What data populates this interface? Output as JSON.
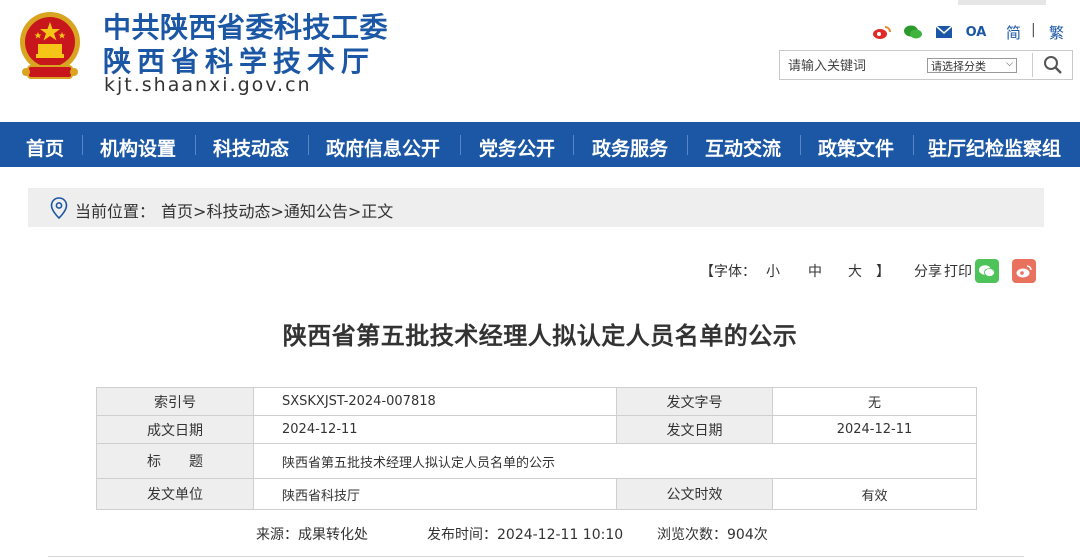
{
  "header": {
    "title_line1": "中共陕西省委科技工委",
    "title_line2": "陕西省科学技术厅",
    "domain": "kjt.shaanxi.gov.cn",
    "icons": [
      "weibo-icon",
      "wechat-icon",
      "mail-icon"
    ],
    "oa_label": "OA",
    "lang_simplified": "简",
    "lang_separator": "|",
    "lang_traditional": "繁",
    "search": {
      "placeholder": "请输入关键词",
      "category_selected": "请选择分类"
    },
    "brand_color": "#1b57a4"
  },
  "nav": {
    "items": [
      "首页",
      "机构设置",
      "科技动态",
      "政府信息公开",
      "党务公开",
      "政务服务",
      "互动交流",
      "政策文件",
      "驻厅纪检监察组"
    ]
  },
  "breadcrumb": {
    "prefix": "当前位置：",
    "items": [
      "首页",
      "科技动态",
      "通知公告",
      "正文"
    ],
    "separator": ">"
  },
  "tools": {
    "font_open": "【字体：",
    "font_small": "小",
    "font_medium": "中",
    "font_large": "大",
    "font_close": "】",
    "share_label": "分享",
    "print_label": "打印",
    "share_icons": [
      "wechat-share-icon",
      "weibo-share-icon"
    ],
    "share_colors": {
      "wechat": "#4ec35a",
      "weibo": "#e9725e"
    }
  },
  "article": {
    "title": "陕西省第五批技术经理人拟认定人员名单的公示"
  },
  "meta": {
    "index_label": "索引号",
    "index_value": "SXSKXJST-2024-007818",
    "doc_no_label": "发文字号",
    "doc_no_value": "无",
    "created_label": "成文日期",
    "created_value": "2024-12-11",
    "issued_label": "发文日期",
    "issued_value": "2024-12-11",
    "subject_label": "标　　题",
    "subject_value": "陕西省第五批技术经理人拟认定人员名单的公示",
    "issuer_label": "发文单位",
    "issuer_value": "陕西省科技厅",
    "validity_label": "公文时效",
    "validity_value": "有效"
  },
  "source": {
    "source_text": "来源：成果转化处",
    "publish_text": "发布时间：2024-12-11 10:10",
    "views_text": "浏览次数：904次"
  }
}
